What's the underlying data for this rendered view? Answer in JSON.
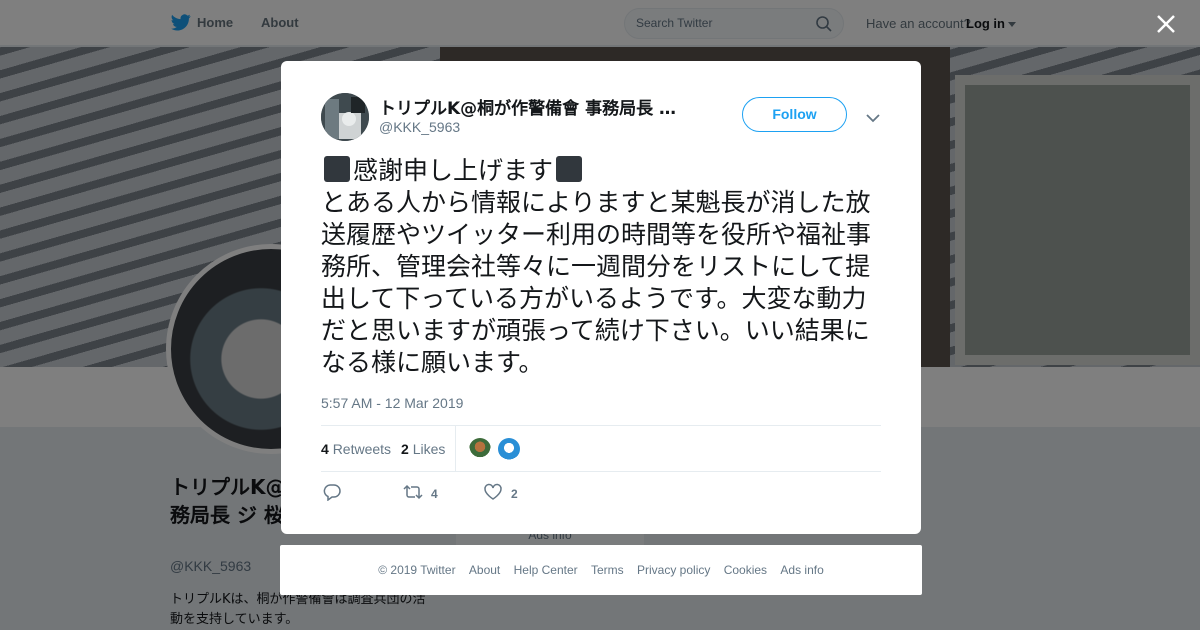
{
  "topnav": {
    "home_label": "Home",
    "about_label": "About",
    "search_placeholder": "Search Twitter",
    "have_account": "Have an account?",
    "login_label": "Log in"
  },
  "background_profile": {
    "name": "トリプルK@桐が作警備會 事務局長 ジ 桜木",
    "handle": "@KKK_5963",
    "bio": "トリプルKは、桐が作警備會は調査兵団の活動を支持しています。",
    "ads_info": "Ads info"
  },
  "tweet": {
    "author_name": "トリプルK@桐が作警備會 事務局長 …",
    "author_handle": "@KKK_5963",
    "follow_label": "Follow",
    "headline": "感謝申し上げます",
    "body": "とある人から情報によりますと某魁長が消した放送履歴やツイッター利用の時間等を役所や福祉事務所、管理会社等々に一週間分をリストにして提出して下っている方がいるようです。大変な動力だと思いますが頑張って続け下さい。いい結果になる様に願います。",
    "timestamp": "5:57 AM - 12 Mar 2019",
    "retweets_count": "4",
    "retweets_label": "Retweets",
    "likes_count": "2",
    "likes_label": "Likes",
    "action_retweet_count": "4",
    "action_like_count": "2"
  },
  "footer": {
    "links": [
      "© 2019 Twitter",
      "About",
      "Help Center",
      "Terms",
      "Privacy policy",
      "Cookies",
      "Ads info"
    ]
  },
  "colors": {
    "accent": "#1da1f2",
    "text_primary": "#14171a",
    "text_secondary": "#657786"
  },
  "icons": [
    "twitter-bird-icon",
    "search-icon",
    "close-icon",
    "chevron-down-icon",
    "reply-icon",
    "retweet-icon",
    "heart-icon"
  ]
}
